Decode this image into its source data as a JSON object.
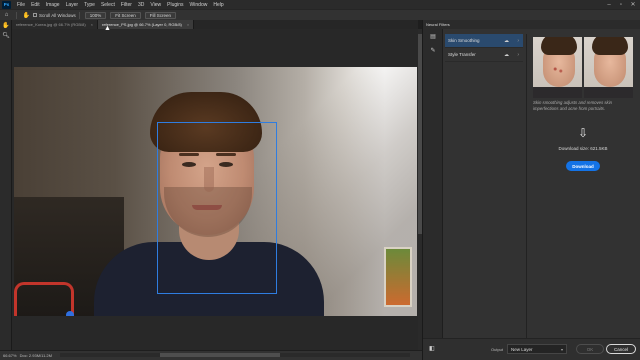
{
  "app": {
    "logo": "Ps",
    "menus": [
      "File",
      "Edit",
      "Image",
      "Layer",
      "Type",
      "Select",
      "Filter",
      "3D",
      "View",
      "Plugins",
      "Window",
      "Help"
    ]
  },
  "options_bar": {
    "scroll_all_windows": "Scroll All Windows",
    "zoom_100": "100%",
    "fit_screen": "Fit Screen",
    "fill_screen": "Fill Screen"
  },
  "tabs": [
    {
      "label": "reference_Korea.jpg @ 66.7% (RGB/8)",
      "close": "×"
    },
    {
      "label": "reference_PS.jpg @ 66.7% (Layer 0, RGB/8)",
      "close": "×"
    }
  ],
  "status": {
    "zoom": "66.67%",
    "doc": "Doc: 2.93M/11.2M"
  },
  "panel": {
    "title": "Neural Filters",
    "filters": [
      {
        "label": "Skin Smoothing",
        "cloud": "☁",
        "chevron": "›"
      },
      {
        "label": "Style Transfer",
        "cloud": "☁",
        "chevron": "›"
      }
    ],
    "description": "Skin smoothing adjusts and removes skin imperfections and acne from portraits.",
    "download_size": "Download size: 621.5KB",
    "download_label": "Download",
    "output_label": "Output",
    "output_value": "New Layer",
    "ok_label": "OK",
    "cancel_label": "Cancel"
  },
  "colors": {
    "accent": "#1473e6",
    "face_box": "#2f7de0",
    "panel_bg": "#323232"
  }
}
